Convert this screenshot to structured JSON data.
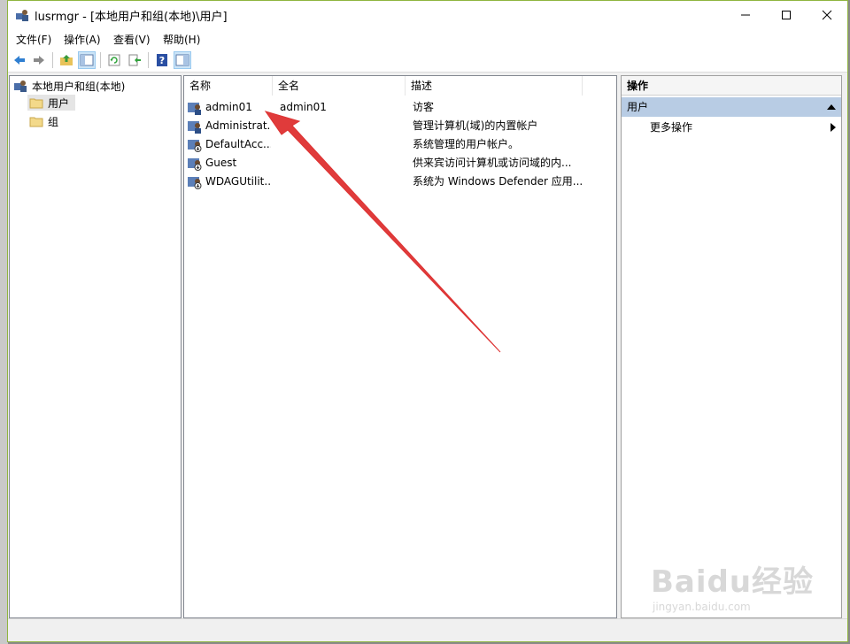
{
  "window": {
    "title": "lusrmgr - [本地用户和组(本地)\\用户]"
  },
  "menu": [
    "文件(F)",
    "操作(A)",
    "查看(V)",
    "帮助(H)"
  ],
  "toolbar": {
    "icons": [
      "back-arrow-icon",
      "forward-arrow-icon",
      "up-folder-icon",
      "show-tree-icon",
      "refresh-icon",
      "export-icon",
      "help-icon",
      "properties-icon"
    ]
  },
  "tree": {
    "root": "本地用户和组(本地)",
    "items": [
      {
        "label": "用户",
        "selected": true
      },
      {
        "label": "组",
        "selected": false
      }
    ]
  },
  "list": {
    "columns": [
      "名称",
      "全名",
      "描述"
    ],
    "rows": [
      {
        "name": "admin01",
        "fullname": "admin01",
        "desc": "访客"
      },
      {
        "name": "Administrat...",
        "fullname": "",
        "desc": "管理计算机(域)的内置帐户"
      },
      {
        "name": "DefaultAcc...",
        "fullname": "",
        "desc": "系统管理的用户帐户。"
      },
      {
        "name": "Guest",
        "fullname": "",
        "desc": "供来宾访问计算机或访问域的内..."
      },
      {
        "name": "WDAGUtilit...",
        "fullname": "",
        "desc": "系统为 Windows Defender 应用..."
      }
    ]
  },
  "actions": {
    "title": "操作",
    "section": "用户",
    "item": "更多操作"
  },
  "watermark": {
    "brand": "Baidu经验",
    "url": "jingyan.baidu.com"
  },
  "colors": {
    "annotation_arrow": "#e03b3b",
    "window_border": "#8fb53f",
    "action_header": "#b8cce4"
  }
}
